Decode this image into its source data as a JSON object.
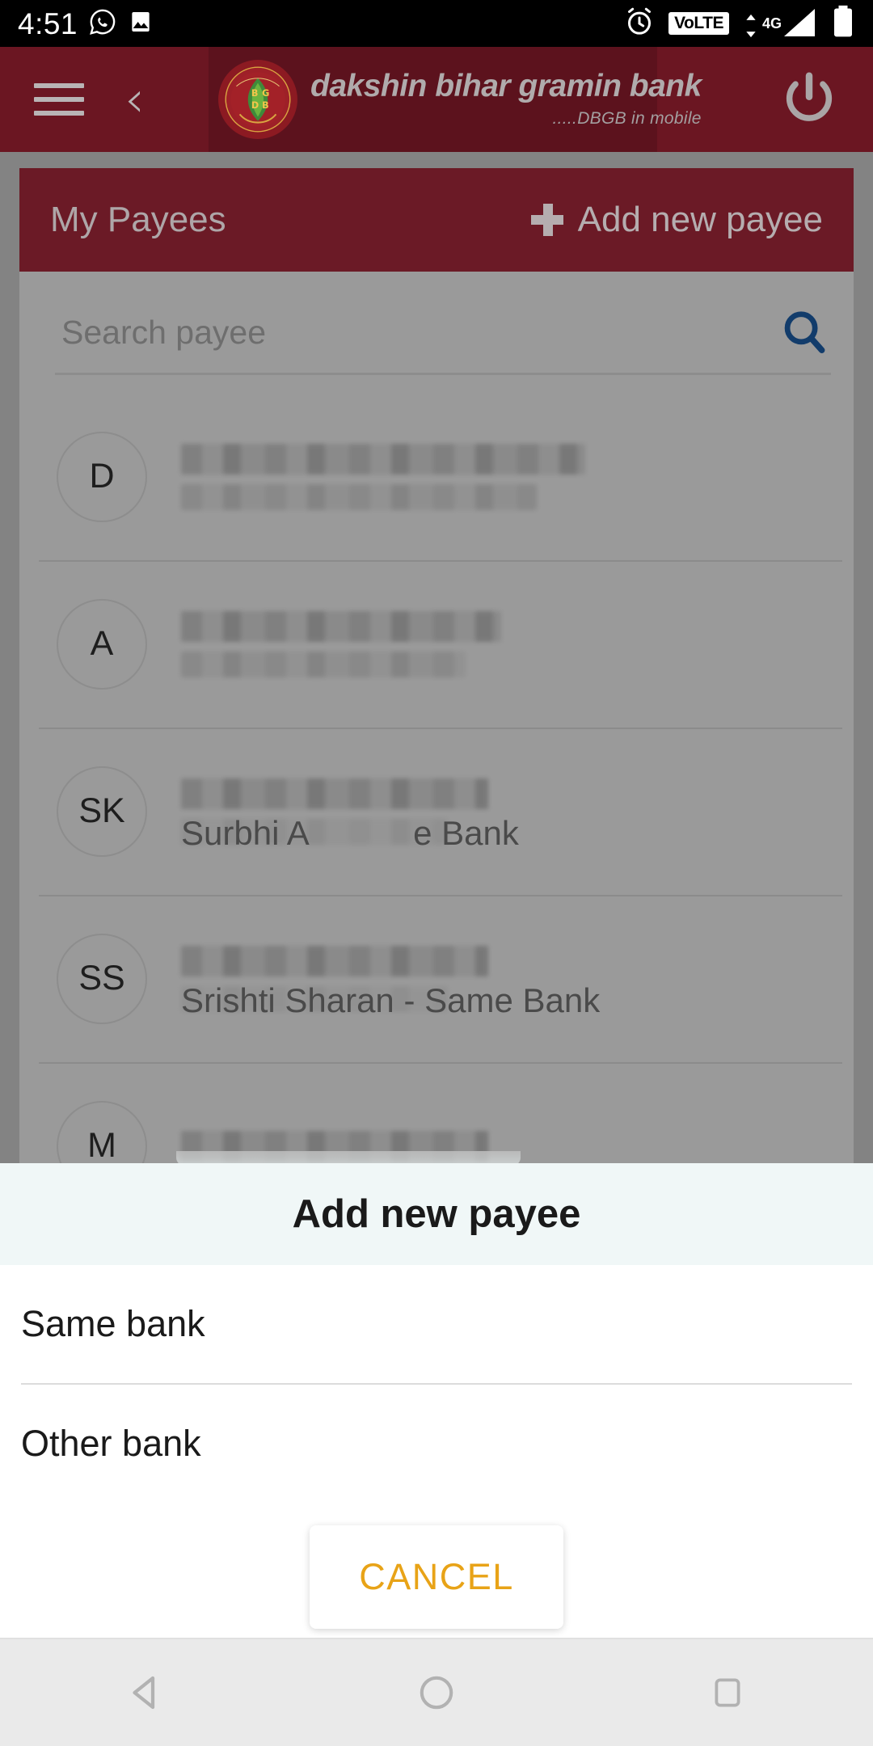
{
  "status_bar": {
    "time": "4:51",
    "left_icons": [
      "whatsapp-icon",
      "image-icon"
    ],
    "volte_label": "VoLTE",
    "network_type": "4G",
    "right_icons": [
      "alarm-icon",
      "volte-badge",
      "signal-icon",
      "battery-icon"
    ]
  },
  "app_header": {
    "menu_icon": "hamburger-icon",
    "back_icon": "back-chevron-icon",
    "logo_icon": "dbgb-bank-logo",
    "brand_name": "dakshin bihar gramin bank",
    "brand_tagline": ".....DBGB in mobile",
    "power_icon": "power-icon",
    "background_color": "#6b1622"
  },
  "payees_screen": {
    "title": "My Payees",
    "add_button_label": "Add new payee",
    "add_button_icon": "plus-icon",
    "search": {
      "placeholder": "Search payee",
      "value": "",
      "icon": "search-icon",
      "icon_color": "#123c6b"
    },
    "rows": [
      {
        "initials": "D",
        "name_redacted": true,
        "visible_text": ""
      },
      {
        "initials": "A",
        "name_redacted": true,
        "visible_text": ""
      },
      {
        "initials": "SK",
        "name_redacted": true,
        "visible_text": "Surbhi A",
        "visible_suffix": "e Bank"
      },
      {
        "initials": "SS",
        "name_redacted": true,
        "visible_text": "Srishti Sharan - Same Bank"
      },
      {
        "initials": "M",
        "name_redacted": true,
        "visible_text": ""
      }
    ]
  },
  "dialog": {
    "title": "Add new payee",
    "options": [
      {
        "label": "Same bank"
      },
      {
        "label": "Other bank"
      }
    ],
    "cancel_label": "CANCEL",
    "cancel_color": "#e8a317",
    "header_color": "#f0f7f7"
  },
  "nav_bar": {
    "back_icon": "nav-back-triangle-icon",
    "home_icon": "nav-home-circle-icon",
    "recents_icon": "nav-recents-square-icon"
  }
}
